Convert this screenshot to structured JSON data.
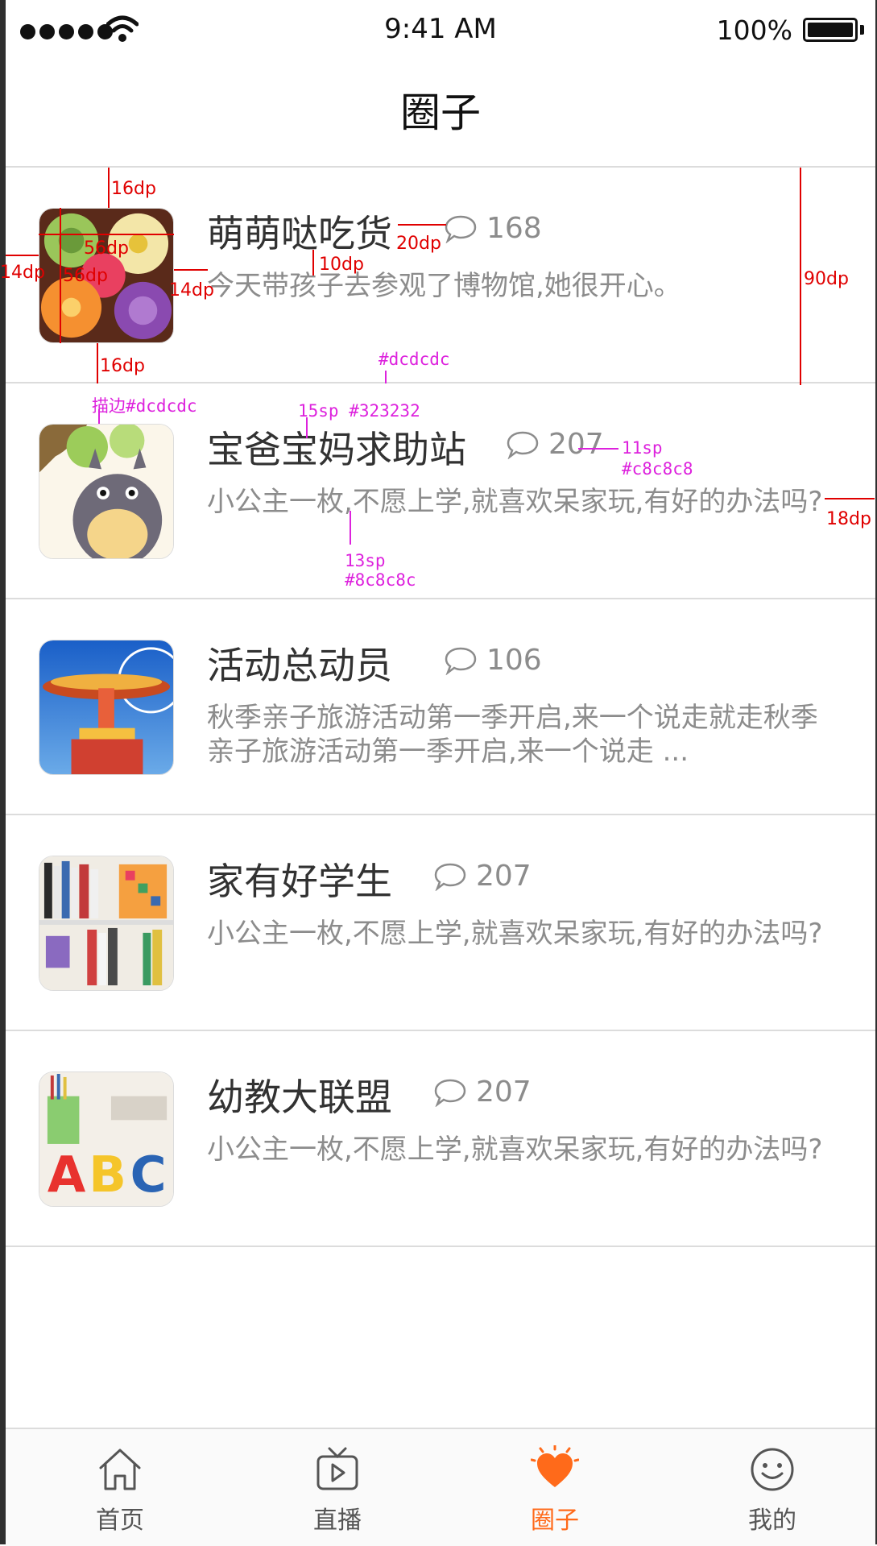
{
  "status_bar": {
    "time": "9:41 AM",
    "battery": "100%"
  },
  "nav": {
    "title": "圈子"
  },
  "groups": [
    {
      "title": "萌萌哒吃货",
      "count": "168",
      "desc": "今天带孩子去参观了博物馆,她很开心。"
    },
    {
      "title": "宝爸宝妈求助站",
      "count": "207",
      "desc": "小公主一枚,不愿上学,就喜欢呆家玩,有好的办法吗?"
    },
    {
      "title": "活动总动员",
      "count": "106",
      "desc": "秋季亲子旅游活动第一季开启,来一个说走就走秋季亲子旅游活动第一季开启,来一个说走 ..."
    },
    {
      "title": "家有好学生",
      "count": "207",
      "desc": "小公主一枚,不愿上学,就喜欢呆家玩,有好的办法吗?"
    },
    {
      "title": "幼教大联盟",
      "count": "207",
      "desc": "小公主一枚,不愿上学,就喜欢呆家玩,有好的办法吗?"
    }
  ],
  "tabs": [
    {
      "label": "首页",
      "icon": "home-icon"
    },
    {
      "label": "直播",
      "icon": "tv-play-icon"
    },
    {
      "label": "圈子",
      "icon": "heart-burst-icon",
      "active": true
    },
    {
      "label": "我的",
      "icon": "smiley-icon"
    }
  ],
  "colors": {
    "accent": "#ff6a1a",
    "title_text": "#323232",
    "desc_text": "#8c8c8c",
    "count_text": "#c8c8c8",
    "divider": "#dcdcdc"
  },
  "annotations": {
    "top_padding": "16dp",
    "thumb_width": "56dp",
    "thumb_height": "56dp",
    "left_padding": "14dp",
    "thumb_text_gap": "14dp",
    "bottom_padding": "16dp",
    "count_gap": "20dp",
    "title_desc_gap": "10dp",
    "row_height": "90dp",
    "right_padding": "18dp",
    "divider_color": "#dcdcdc",
    "stroke_color": "描边#dcdcdc",
    "title_spec": "15sp #323232",
    "count_size": "11sp",
    "count_color": "#c8c8c8",
    "desc_size": "13sp",
    "desc_color": "#8c8c8c"
  }
}
